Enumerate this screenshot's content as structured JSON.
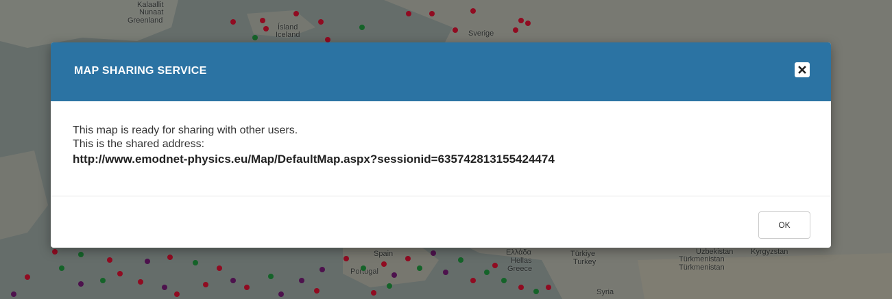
{
  "map": {
    "labels": [
      "Kalaallit",
      "Nunaat",
      "Greenland",
      "Ísland",
      "Iceland",
      "Sverige",
      "Spain",
      "Portugal",
      "Ελλάδα",
      "Hellas",
      "Greece",
      "Türkiye",
      "Turkey",
      "Türkmenistan",
      "Türkmenistan",
      "Uzbekistan",
      "Kyrgyzstan",
      "Syria"
    ]
  },
  "modal": {
    "title": "MAP SHARING SERVICE",
    "body": {
      "line1": "This map is ready for sharing with other users.",
      "line2": "This is the shared address:",
      "url": "http://www.emodnet-physics.eu/Map/DefaultMap.aspx?sessionid=635742813155424474"
    },
    "ok_label": "OK"
  },
  "colors": {
    "header": "#2b73a3",
    "marker_red": "#c8102e",
    "marker_green": "#1e8a3a",
    "marker_purple": "#6b1a6b"
  }
}
